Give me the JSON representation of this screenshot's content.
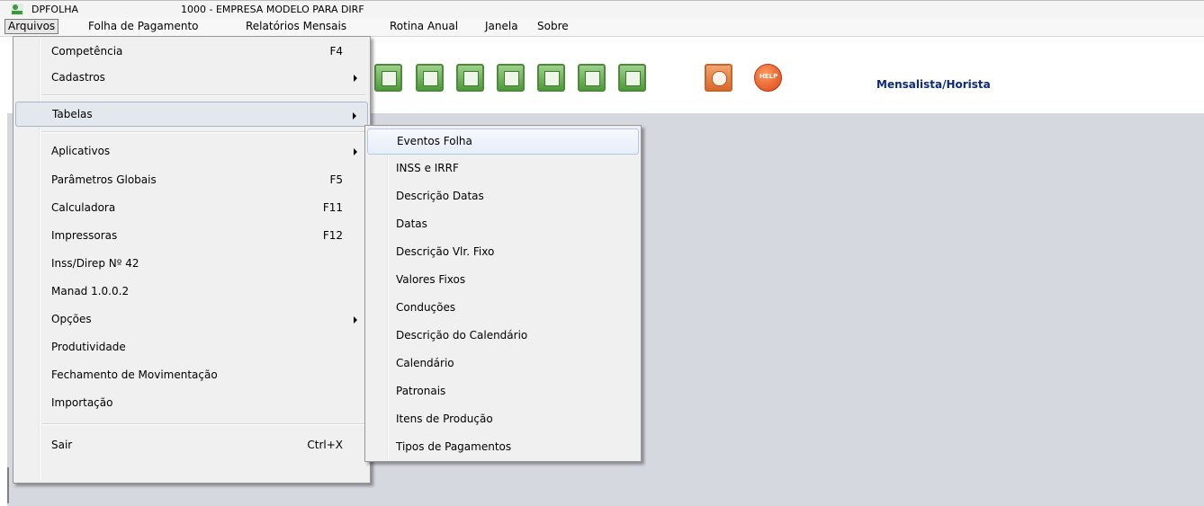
{
  "window": {
    "app_name": "DPFOLHA",
    "company": "1000 - EMPRESA MODELO PARA DIRF"
  },
  "menubar": {
    "items": [
      {
        "label": "Arquivos"
      },
      {
        "label": "Folha de Pagamento"
      },
      {
        "label": "Relatórios Mensais"
      },
      {
        "label": "Rotina Anual"
      },
      {
        "label": "Janela"
      },
      {
        "label": "Sobre"
      }
    ]
  },
  "toolbar": {
    "mode_label": "Mensalista/Horista",
    "help_label": "HELP"
  },
  "arquivos_menu": {
    "items": [
      {
        "label": "Competência",
        "shortcut": "F4"
      },
      {
        "label": "Cadastros",
        "shortcut": ""
      },
      {
        "label": "Tabelas",
        "shortcut": ""
      },
      {
        "label": "Aplicativos",
        "shortcut": ""
      },
      {
        "label": "Parâmetros Globais",
        "shortcut": "F5"
      },
      {
        "label": "Calculadora",
        "shortcut": "F11"
      },
      {
        "label": "Impressoras",
        "shortcut": "F12"
      },
      {
        "label": "Inss/Direp Nº 42",
        "shortcut": ""
      },
      {
        "label": "Manad 1.0.0.2",
        "shortcut": ""
      },
      {
        "label": "Opções",
        "shortcut": ""
      },
      {
        "label": "Produtividade",
        "shortcut": ""
      },
      {
        "label": "Fechamento de Movimentação",
        "shortcut": ""
      },
      {
        "label": "Importação",
        "shortcut": ""
      },
      {
        "label": "Sair",
        "shortcut": "Ctrl+X"
      }
    ]
  },
  "tabelas_submenu": {
    "items": [
      {
        "label": "Eventos Folha"
      },
      {
        "label": "INSS e IRRF"
      },
      {
        "label": "Descrição Datas"
      },
      {
        "label": "Datas"
      },
      {
        "label": "Descrição Vlr. Fixo"
      },
      {
        "label": "Valores Fixos"
      },
      {
        "label": "Conduções"
      },
      {
        "label": "Descrição do Calendário"
      },
      {
        "label": "Calendário"
      },
      {
        "label": "Patronais"
      },
      {
        "label": "Itens de Produção"
      },
      {
        "label": "Tipos de Pagamentos"
      }
    ]
  }
}
